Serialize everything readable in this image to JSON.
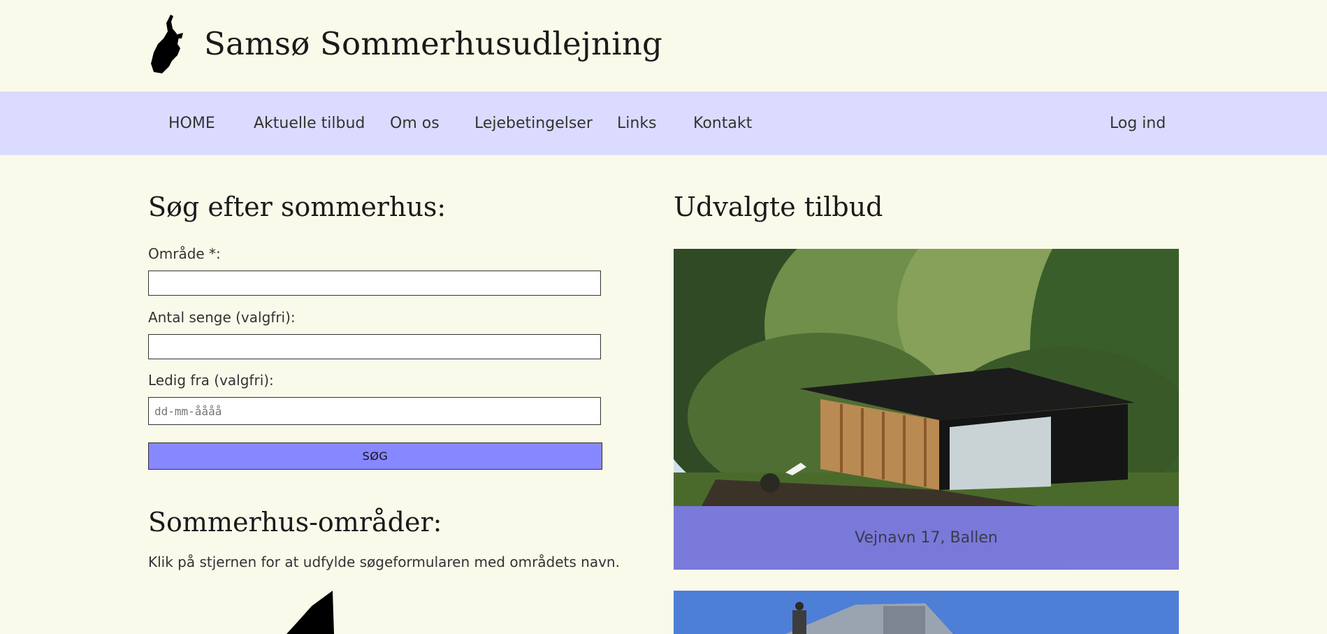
{
  "site": {
    "title": "Samsø Sommerhusudlejning"
  },
  "nav": {
    "items": [
      "HOME",
      "Aktuelle tilbud",
      "Om os",
      "Lejebetingelser",
      "Links",
      "Kontakt"
    ],
    "login": "Log ind"
  },
  "search": {
    "title": "Søg efter sommerhus:",
    "area_label": "Område *:",
    "beds_label": "Antal senge (valgfri):",
    "date_label": "Ledig fra (valgfri):",
    "date_placeholder": "dd-mm-åååå",
    "button_label": "SØG"
  },
  "areas": {
    "title": "Sommerhus-områder:",
    "help": "Klik på stjernen for at udfylde søgeformularen med områdets navn."
  },
  "offers": {
    "title": "Udvalgte tilbud",
    "cards": [
      {
        "caption": "Vejnavn 17, Ballen"
      }
    ]
  }
}
